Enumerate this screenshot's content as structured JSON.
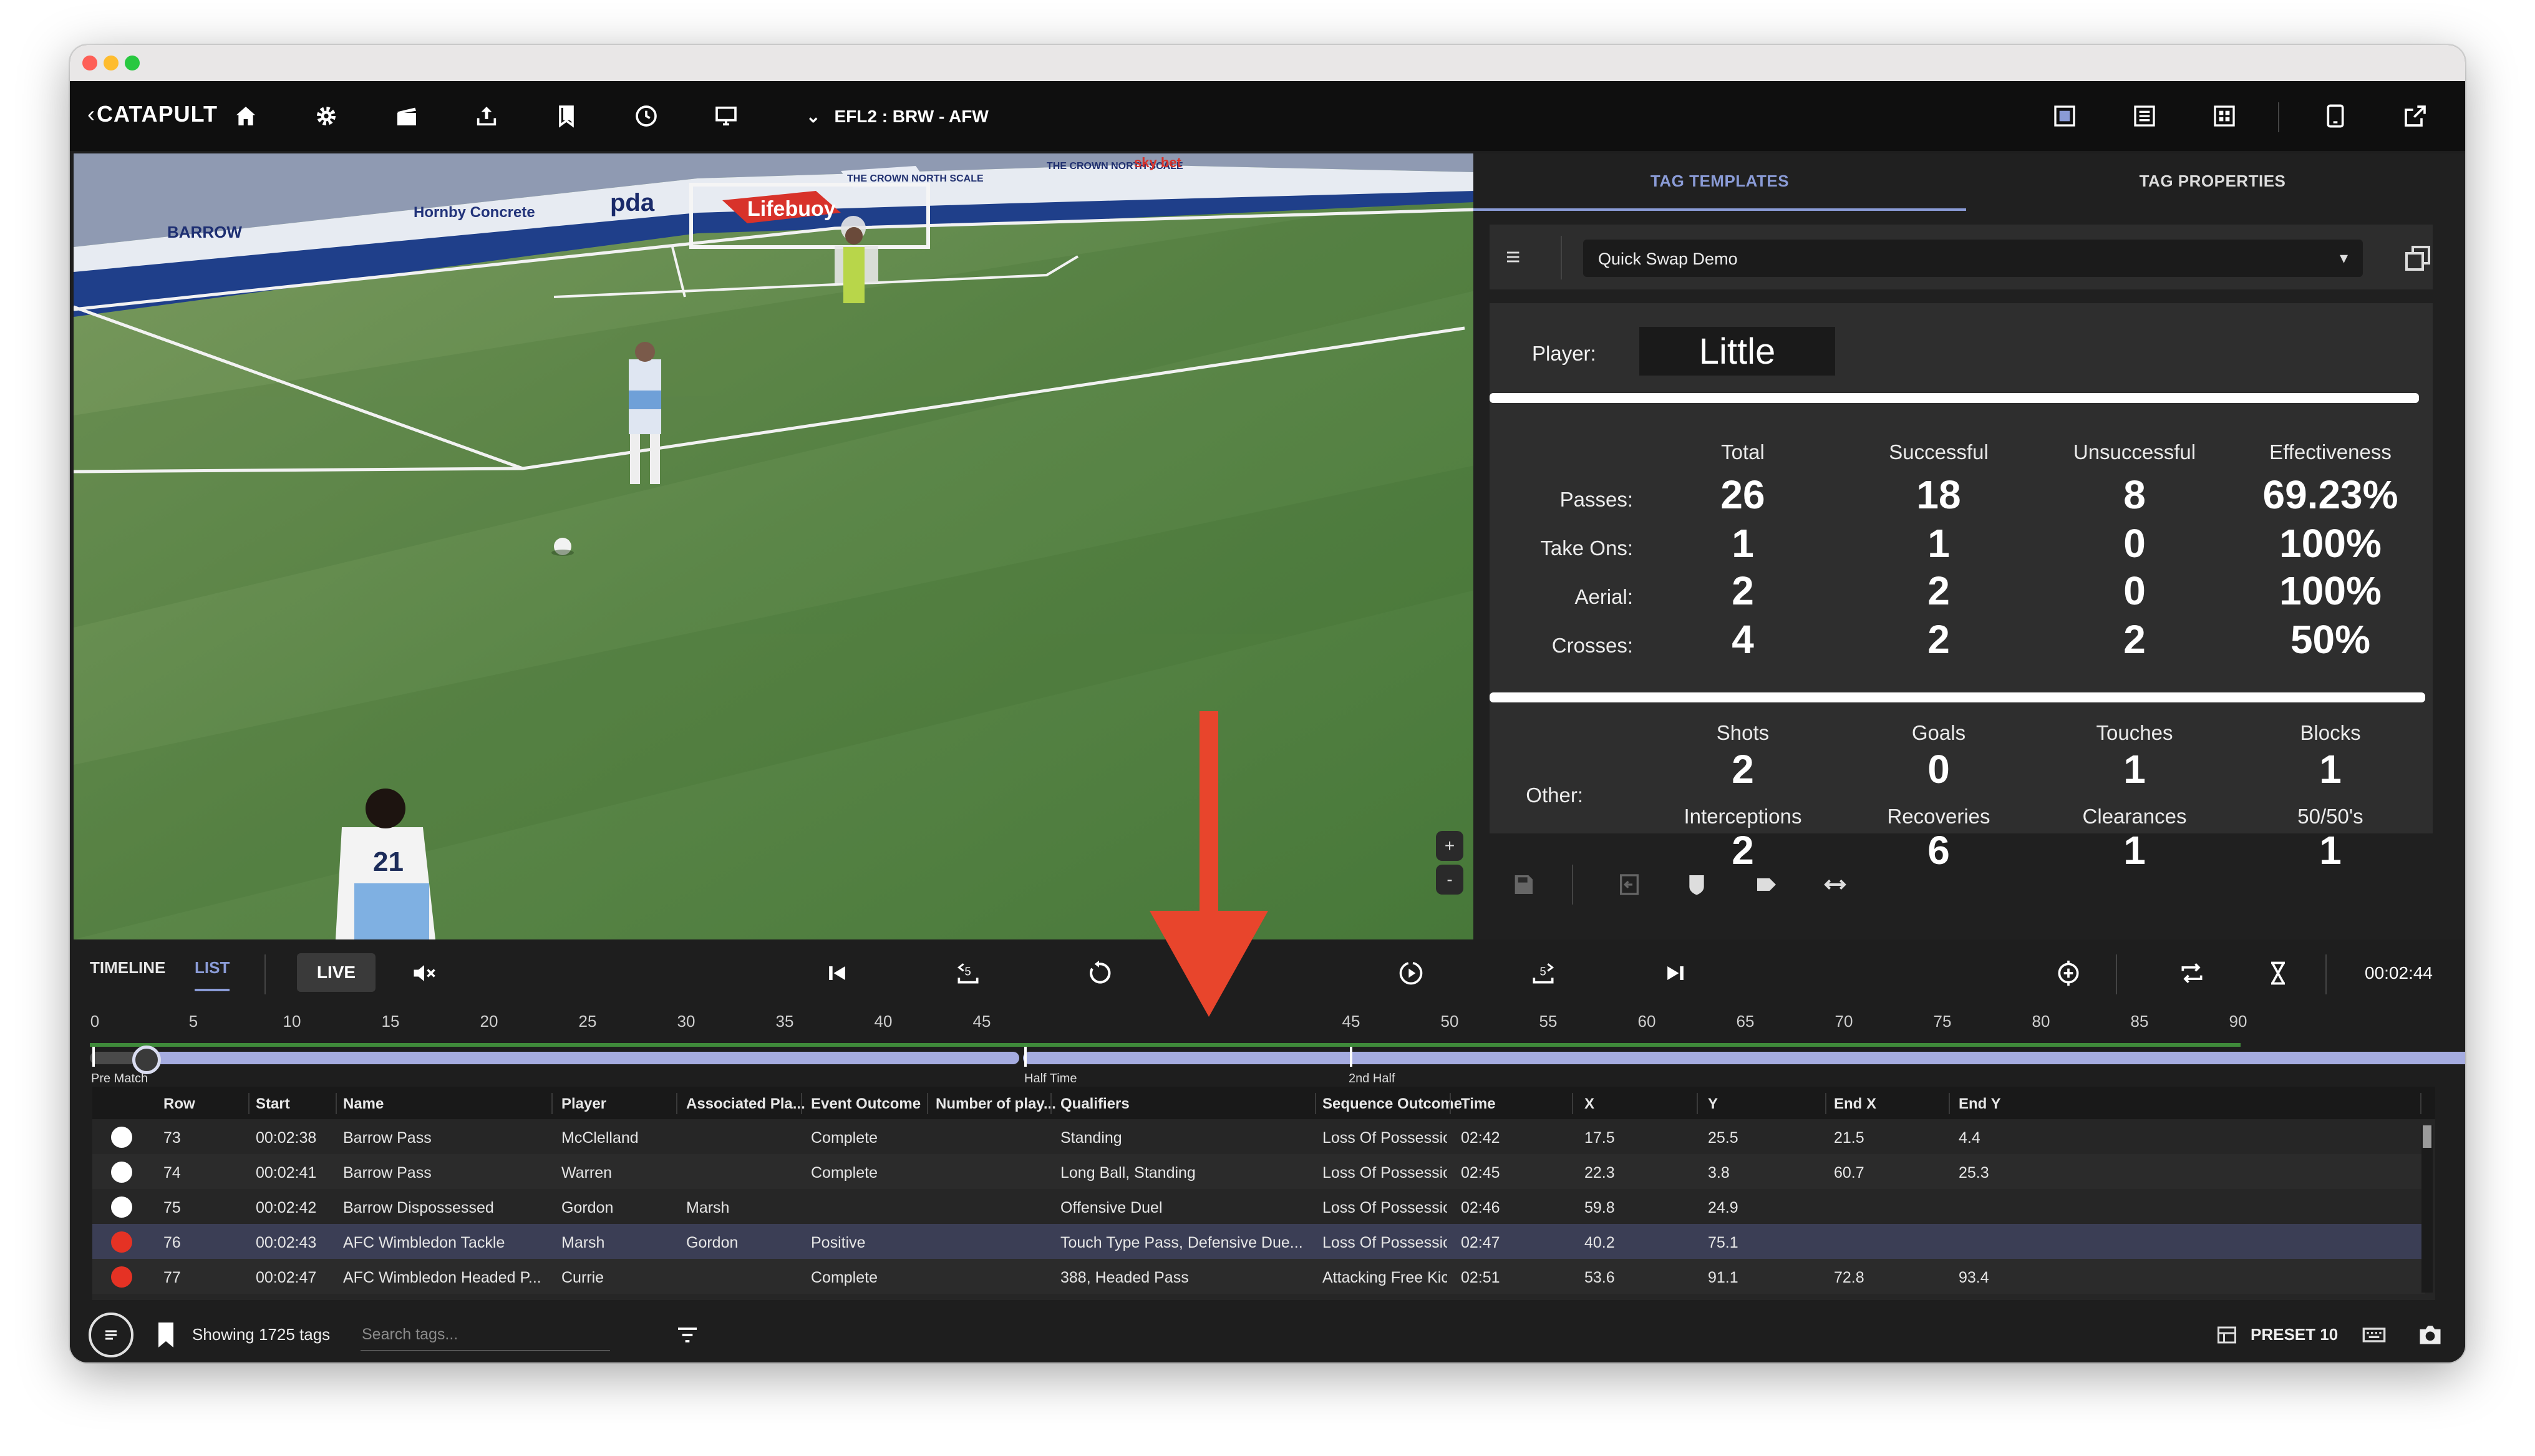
{
  "app": {
    "brand": "CATAPULT",
    "match": "EFL2 : BRW - AFW"
  },
  "toolbar": {
    "left_icons": [
      "home-icon",
      "settings-gear-icon",
      "clapperboard-icon",
      "upload-icon",
      "bookmark-icon",
      "clock-icon",
      "monitor-icon"
    ],
    "right_icons": [
      "layout-video-icon",
      "layout-list-icon",
      "layout-grid-icon",
      "tablet-icon",
      "external-link-icon"
    ]
  },
  "right_panel": {
    "tabs": [
      {
        "label": "TAG TEMPLATES",
        "active": true
      },
      {
        "label": "TAG PROPERTIES",
        "active": false
      }
    ],
    "template_select": "Quick Swap Demo",
    "player_label": "Player:",
    "player_value": "Little",
    "pass_table": {
      "columns": [
        "Total",
        "Successful",
        "Unsuccessful",
        "Effectiveness"
      ],
      "rows": [
        {
          "label": "Passes:",
          "values": [
            "26",
            "18",
            "8",
            "69.23%"
          ]
        },
        {
          "label": "Take Ons:",
          "values": [
            "1",
            "1",
            "0",
            "100%"
          ]
        },
        {
          "label": "Aerial:",
          "values": [
            "2",
            "2",
            "0",
            "100%"
          ]
        },
        {
          "label": "Crosses:",
          "values": [
            "4",
            "2",
            "2",
            "50%"
          ]
        }
      ]
    },
    "other": {
      "label": "Other:",
      "cells": [
        {
          "title": "Shots",
          "value": "2"
        },
        {
          "title": "Goals",
          "value": "0"
        },
        {
          "title": "Touches",
          "value": "1"
        },
        {
          "title": "Blocks",
          "value": "1"
        },
        {
          "title": "Interceptions",
          "value": "2"
        },
        {
          "title": "Recoveries",
          "value": "6"
        },
        {
          "title": "Clearances",
          "value": "1"
        },
        {
          "title": "50/50's",
          "value": "1"
        }
      ]
    }
  },
  "controls": {
    "timeline_tab": "TIMELINE",
    "list_tab": "LIST",
    "live_label": "LIVE",
    "clock": "00:02:44"
  },
  "timeline": {
    "ticks_first_half": [
      "0",
      "5",
      "10",
      "15",
      "20",
      "25",
      "30",
      "35",
      "40",
      "45"
    ],
    "ticks_second_half": [
      "45",
      "50",
      "55",
      "60",
      "65",
      "70",
      "75",
      "80",
      "85",
      "90"
    ],
    "phase_pre": "Pre Match",
    "phase_half": "Half Time",
    "phase_second": "2nd Half"
  },
  "table": {
    "headers": [
      "Row",
      "Start",
      "Name",
      "Player",
      "Associated Pla...",
      "Event Outcome",
      "Number of play...",
      "Qualifiers",
      "Sequence Outcome",
      "Time",
      "X",
      "Y",
      "End X",
      "End Y"
    ],
    "rows": [
      {
        "dot": "#ffffff",
        "row": "73",
        "start": "00:02:38",
        "name": "Barrow Pass",
        "player": "McClelland",
        "assoc": "",
        "outcome": "Complete",
        "num": "",
        "qualifiers": "Standing",
        "seq": "Loss Of Possession",
        "time": "02:42",
        "x": "17.5",
        "y": "25.5",
        "endx": "21.5",
        "endy": "4.4"
      },
      {
        "dot": "#ffffff",
        "row": "74",
        "start": "00:02:41",
        "name": "Barrow Pass",
        "player": "Warren",
        "assoc": "",
        "outcome": "Complete",
        "num": "",
        "qualifiers": "Long Ball, Standing",
        "seq": "Loss Of Possession",
        "time": "02:45",
        "x": "22.3",
        "y": "3.8",
        "endx": "60.7",
        "endy": "25.3"
      },
      {
        "dot": "#ffffff",
        "row": "75",
        "start": "00:02:42",
        "name": "Barrow Dispossessed",
        "player": "Gordon",
        "assoc": "Marsh",
        "outcome": "",
        "num": "",
        "qualifiers": "Offensive Duel",
        "seq": "Loss Of Possession",
        "time": "02:46",
        "x": "59.8",
        "y": "24.9",
        "endx": "",
        "endy": ""
      },
      {
        "dot": "#e53224",
        "row": "76",
        "start": "00:02:43",
        "name": "AFC Wimbledon Tackle",
        "player": "Marsh",
        "assoc": "Gordon",
        "outcome": "Positive",
        "num": "",
        "qualifiers": "Touch Type Pass, Defensive Due...",
        "seq": "Loss Of Possession",
        "time": "02:47",
        "x": "40.2",
        "y": "75.1",
        "endx": "",
        "endy": ""
      },
      {
        "dot": "#e53224",
        "row": "77",
        "start": "00:02:47",
        "name": "AFC Wimbledon Headed P...",
        "player": "Currie",
        "assoc": "",
        "outcome": "Complete",
        "num": "",
        "qualifiers": "388, Headed Pass",
        "seq": "Attacking Free Kick W...",
        "time": "02:51",
        "x": "53.6",
        "y": "91.1",
        "endx": "72.8",
        "endy": "93.4"
      }
    ]
  },
  "footer": {
    "showing": "Showing 1725 tags",
    "search_placeholder": "Search tags...",
    "preset": "PRESET 10"
  },
  "video": {
    "stadium_signs": [
      "BARROW",
      "Hornby Concrete",
      "pda",
      "Lifebuoy",
      "THE CROWN NORTH SCALE",
      "THE CROWN NORTH SCALE",
      "sky bet"
    ],
    "shirt_number": "21"
  },
  "colors": {
    "accent": "#8a9bd6",
    "timeline_track": "#a5ace0",
    "tag_red": "#e53224",
    "annotation_arrow": "#e8452c"
  }
}
